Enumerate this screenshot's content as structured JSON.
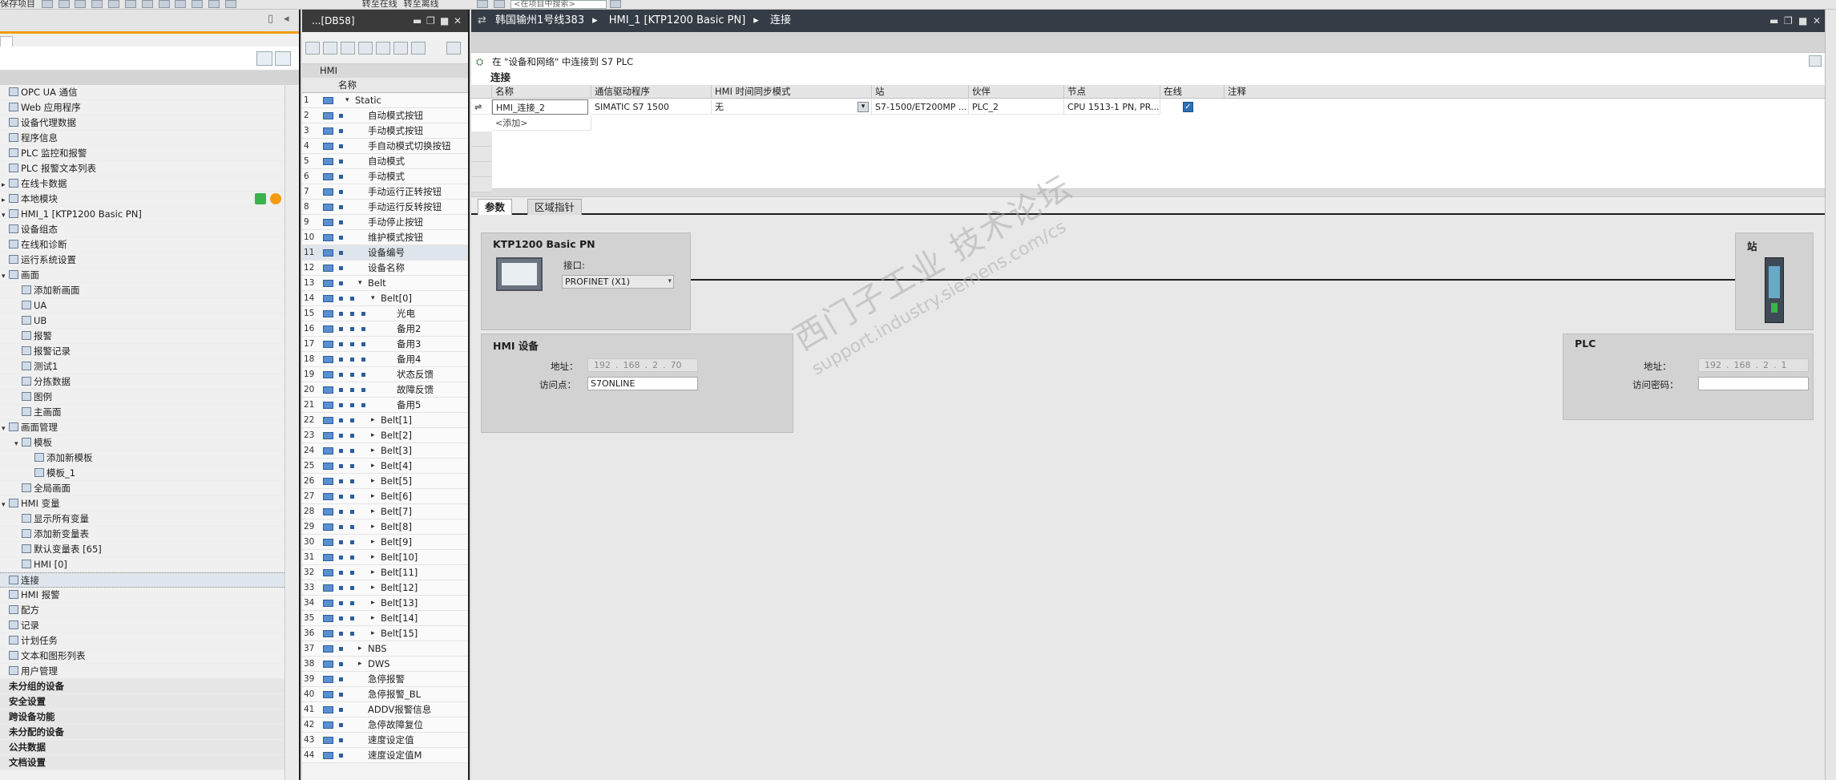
{
  "toolbar": {
    "save_project": "保存项目",
    "go_online": "转至在线",
    "go_offline": "转至离线",
    "search_placeholder": "<在项目中搜索>"
  },
  "tree": {
    "items": [
      {
        "label": "OPC UA 通信",
        "indent": 0
      },
      {
        "label": "Web 应用程序",
        "indent": 0
      },
      {
        "label": "设备代理数据",
        "indent": 0
      },
      {
        "label": "程序信息",
        "indent": 0
      },
      {
        "label": "PLC 监控和报警",
        "indent": 0
      },
      {
        "label": "PLC 报警文本列表",
        "indent": 0
      },
      {
        "label": "在线卡数据",
        "indent": 0,
        "expand": "▸"
      },
      {
        "label": "本地模块",
        "indent": 0,
        "expand": "▸",
        "status": true
      },
      {
        "label": "HMI_1 [KTP1200 Basic PN]",
        "indent": 0,
        "expand": "▾"
      },
      {
        "label": "设备组态",
        "indent": 0
      },
      {
        "label": "在线和诊断",
        "indent": 0
      },
      {
        "label": "运行系统设置",
        "indent": 0
      },
      {
        "label": "画面",
        "indent": 0,
        "expand": "▾"
      },
      {
        "label": "添加新画面",
        "indent": 1
      },
      {
        "label": "UA",
        "indent": 1
      },
      {
        "label": "UB",
        "indent": 1
      },
      {
        "label": "报警",
        "indent": 1
      },
      {
        "label": "报警记录",
        "indent": 1
      },
      {
        "label": "测试1",
        "indent": 1
      },
      {
        "label": "分拣数据",
        "indent": 1
      },
      {
        "label": "图例",
        "indent": 1
      },
      {
        "label": "主画面",
        "indent": 1
      },
      {
        "label": "画面管理",
        "indent": 0,
        "expand": "▾"
      },
      {
        "label": "模板",
        "indent": 1,
        "expand": "▾"
      },
      {
        "label": "添加新模板",
        "indent": 2
      },
      {
        "label": "模板_1",
        "indent": 2
      },
      {
        "label": "全局画面",
        "indent": 1
      },
      {
        "label": "HMI 变量",
        "indent": 0,
        "expand": "▾"
      },
      {
        "label": "显示所有变量",
        "indent": 1
      },
      {
        "label": "添加新变量表",
        "indent": 1
      },
      {
        "label": "默认变量表 [65]",
        "indent": 1
      },
      {
        "label": "HMI [0]",
        "indent": 1
      },
      {
        "label": "连接",
        "indent": 0,
        "selected": true
      },
      {
        "label": "HMI 报警",
        "indent": 0
      },
      {
        "label": "配方",
        "indent": 0
      },
      {
        "label": "记录",
        "indent": 0
      },
      {
        "label": "计划任务",
        "indent": 0
      },
      {
        "label": "文本和图形列表",
        "indent": 0
      },
      {
        "label": "用户管理",
        "indent": 0
      },
      {
        "label": "未分组的设备",
        "indent": 0,
        "bold": true
      },
      {
        "label": "安全设置",
        "indent": 0,
        "bold": true
      },
      {
        "label": "跨设备功能",
        "indent": 0,
        "bold": true
      },
      {
        "label": "未分配的设备",
        "indent": 0,
        "bold": true
      },
      {
        "label": "公共数据",
        "indent": 0,
        "bold": true
      },
      {
        "label": "文档设置",
        "indent": 0,
        "bold": true
      }
    ]
  },
  "db": {
    "title": "...[DB58]",
    "group": "HMI",
    "col_name": "名称",
    "rows": [
      {
        "n": "1",
        "name": "Static",
        "lvl": 0,
        "exp": "▾"
      },
      {
        "n": "2",
        "name": "自动模式按钮",
        "lvl": 1
      },
      {
        "n": "3",
        "name": "手动模式按钮",
        "lvl": 1
      },
      {
        "n": "4",
        "name": "手自动模式切换按钮",
        "lvl": 1
      },
      {
        "n": "5",
        "name": "自动模式",
        "lvl": 1
      },
      {
        "n": "6",
        "name": "手动模式",
        "lvl": 1
      },
      {
        "n": "7",
        "name": "手动运行正转按钮",
        "lvl": 1
      },
      {
        "n": "8",
        "name": "手动运行反转按钮",
        "lvl": 1
      },
      {
        "n": "9",
        "name": "手动停止按钮",
        "lvl": 1
      },
      {
        "n": "10",
        "name": "维护模式按钮",
        "lvl": 1
      },
      {
        "n": "11",
        "name": "设备编号",
        "lvl": 1,
        "hl": true
      },
      {
        "n": "12",
        "name": "设备名称",
        "lvl": 1
      },
      {
        "n": "13",
        "name": "Belt",
        "lvl": 1,
        "exp": "▾"
      },
      {
        "n": "14",
        "name": "Belt[0]",
        "lvl": 2,
        "exp": "▾"
      },
      {
        "n": "15",
        "name": "光电",
        "lvl": 3
      },
      {
        "n": "16",
        "name": "备用2",
        "lvl": 3
      },
      {
        "n": "17",
        "name": "备用3",
        "lvl": 3
      },
      {
        "n": "18",
        "name": "备用4",
        "lvl": 3
      },
      {
        "n": "19",
        "name": "状态反馈",
        "lvl": 3
      },
      {
        "n": "20",
        "name": "故障反馈",
        "lvl": 3
      },
      {
        "n": "21",
        "name": "备用5",
        "lvl": 3
      },
      {
        "n": "22",
        "name": "Belt[1]",
        "lvl": 2,
        "exp": "▸"
      },
      {
        "n": "23",
        "name": "Belt[2]",
        "lvl": 2,
        "exp": "▸"
      },
      {
        "n": "24",
        "name": "Belt[3]",
        "lvl": 2,
        "exp": "▸"
      },
      {
        "n": "25",
        "name": "Belt[4]",
        "lvl": 2,
        "exp": "▸"
      },
      {
        "n": "26",
        "name": "Belt[5]",
        "lvl": 2,
        "exp": "▸"
      },
      {
        "n": "27",
        "name": "Belt[6]",
        "lvl": 2,
        "exp": "▸"
      },
      {
        "n": "28",
        "name": "Belt[7]",
        "lvl": 2,
        "exp": "▸"
      },
      {
        "n": "29",
        "name": "Belt[8]",
        "lvl": 2,
        "exp": "▸"
      },
      {
        "n": "30",
        "name": "Belt[9]",
        "lvl": 2,
        "exp": "▸"
      },
      {
        "n": "31",
        "name": "Belt[10]",
        "lvl": 2,
        "exp": "▸"
      },
      {
        "n": "32",
        "name": "Belt[11]",
        "lvl": 2,
        "exp": "▸"
      },
      {
        "n": "33",
        "name": "Belt[12]",
        "lvl": 2,
        "exp": "▸"
      },
      {
        "n": "34",
        "name": "Belt[13]",
        "lvl": 2,
        "exp": "▸"
      },
      {
        "n": "35",
        "name": "Belt[14]",
        "lvl": 2,
        "exp": "▸"
      },
      {
        "n": "36",
        "name": "Belt[15]",
        "lvl": 2,
        "exp": "▸"
      },
      {
        "n": "37",
        "name": "NBS",
        "lvl": 1,
        "exp": "▸"
      },
      {
        "n": "38",
        "name": "DWS",
        "lvl": 1,
        "exp": "▸"
      },
      {
        "n": "39",
        "name": "急停报警",
        "lvl": 1
      },
      {
        "n": "40",
        "name": "急停报警_BL",
        "lvl": 1
      },
      {
        "n": "41",
        "name": "ADDV报警信息",
        "lvl": 1
      },
      {
        "n": "42",
        "name": "急停故障复位",
        "lvl": 1
      },
      {
        "n": "43",
        "name": "速度设定值",
        "lvl": 1
      },
      {
        "n": "44",
        "name": "速度设定值M",
        "lvl": 1
      }
    ]
  },
  "main": {
    "breadcrumb": [
      "韩国输州1号线383",
      "HMI_1 [KTP1200 Basic PN]",
      "连接"
    ],
    "info": "在 \"设备和网络\" 中连接到 S7 PLC",
    "section": "连接",
    "columns": [
      "名称",
      "通信驱动程序",
      "HMI 时间同步模式",
      "站",
      "伙伴",
      "节点",
      "在线",
      "注释"
    ],
    "row": {
      "name": "HMI_连接_2",
      "driver": "SIMATIC S7 1500",
      "sync": "无",
      "station": "S7-1500/ET200MP ...",
      "partner": "PLC_2",
      "node": "CPU 1513-1 PN, PR...",
      "online": true
    },
    "add_row": "<添加>",
    "tabs": [
      "参数",
      "区域指针"
    ],
    "hmi_device": {
      "title": "KTP1200 Basic PN",
      "interface_label": "接口:",
      "interface_value": "PROFINET (X1)"
    },
    "hmi_settings": {
      "title": "HMI 设备",
      "address_label": "地址：",
      "address": [
        "192",
        "168",
        "2",
        "70"
      ],
      "access_label": "访问点：",
      "access_value": "S7ONLINE"
    },
    "station": {
      "title": "站"
    },
    "plc": {
      "title": "PLC",
      "address_label": "地址：",
      "address": [
        "192",
        "168",
        "2",
        "1"
      ],
      "password_label": "访问密码："
    },
    "watermark": {
      "line1": "西门子工业 技术论坛",
      "line2": "support.industry.siemens.com/cs"
    }
  },
  "colors": {
    "accent": "#f39c12",
    "title_bar": "#353c46",
    "selected": "#dfe6ee"
  }
}
